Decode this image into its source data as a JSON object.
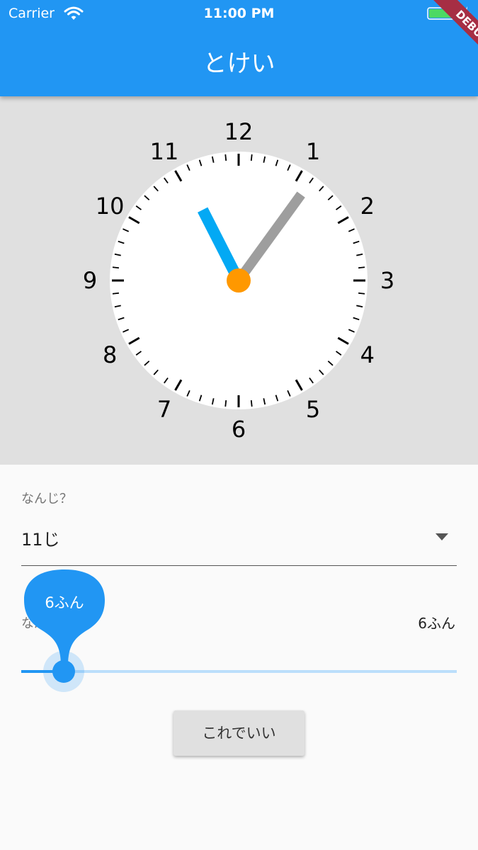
{
  "status_bar": {
    "carrier": "Carrier",
    "time": "11:00 PM"
  },
  "debug_banner": "DEBUG",
  "app_bar": {
    "title": "とけい"
  },
  "clock": {
    "numbers": [
      "12",
      "1",
      "2",
      "3",
      "4",
      "5",
      "6",
      "7",
      "8",
      "9",
      "10",
      "11"
    ],
    "hour": 11,
    "minute": 6,
    "colors": {
      "face": "#ffffff",
      "background": "#e0e0e0",
      "hour_hand": "#03a9f4",
      "minute_hand": "#9e9e9e",
      "center": "#ff9800"
    }
  },
  "form": {
    "hour_label": "なんじ？",
    "hour_value": "11じ",
    "minute_label": "なんぷん？",
    "minute_value": "6ふん",
    "slider_indicator": "6ふん",
    "slider": {
      "value": 6,
      "min": 0,
      "max": 59
    },
    "submit_label": "これでいい"
  },
  "colors": {
    "primary": "#2196f3",
    "slider_track": "#bbdefb"
  }
}
